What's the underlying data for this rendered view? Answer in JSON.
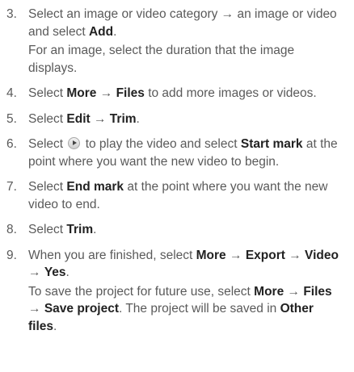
{
  "steps": [
    {
      "number": "3.",
      "paragraphs": [
        [
          {
            "t": "Select an image or video category → an image or video and select "
          },
          {
            "t": "Add",
            "b": true
          },
          {
            "t": "."
          }
        ],
        [
          {
            "t": "For an image, select the duration that the image displays."
          }
        ]
      ]
    },
    {
      "number": "4.",
      "paragraphs": [
        [
          {
            "t": "Select "
          },
          {
            "t": "More",
            "b": true
          },
          {
            "t": " → "
          },
          {
            "t": "Files",
            "b": true
          },
          {
            "t": " to add more images or videos."
          }
        ]
      ]
    },
    {
      "number": "5.",
      "paragraphs": [
        [
          {
            "t": "Select "
          },
          {
            "t": "Edit",
            "b": true
          },
          {
            "t": " → "
          },
          {
            "t": "Trim",
            "b": true
          },
          {
            "t": "."
          }
        ]
      ]
    },
    {
      "number": "6.",
      "paragraphs": [
        [
          {
            "t": "Select "
          },
          {
            "icon": "play-icon"
          },
          {
            "t": " to play the video and select "
          },
          {
            "t": "Start mark",
            "b": true
          },
          {
            "t": " at the point where you want the new video to begin."
          }
        ]
      ]
    },
    {
      "number": "7.",
      "paragraphs": [
        [
          {
            "t": "Select "
          },
          {
            "t": "End mark",
            "b": true
          },
          {
            "t": " at the point where you want the new video to end."
          }
        ]
      ]
    },
    {
      "number": "8.",
      "paragraphs": [
        [
          {
            "t": "Select "
          },
          {
            "t": "Trim",
            "b": true
          },
          {
            "t": "."
          }
        ]
      ]
    },
    {
      "number": "9.",
      "paragraphs": [
        [
          {
            "t": "When you are finished, select "
          },
          {
            "t": "More",
            "b": true
          },
          {
            "t": " → "
          },
          {
            "t": "Export",
            "b": true
          },
          {
            "t": " → "
          },
          {
            "t": "Video",
            "b": true
          },
          {
            "t": " → "
          },
          {
            "t": "Yes",
            "b": true
          },
          {
            "t": "."
          }
        ],
        [
          {
            "t": "To save the project for future use, select "
          },
          {
            "t": "More",
            "b": true
          },
          {
            "t": " → "
          },
          {
            "t": "Files",
            "b": true
          },
          {
            "t": " → "
          },
          {
            "t": "Save project",
            "b": true
          },
          {
            "t": ". The project will be saved in "
          },
          {
            "t": "Other files",
            "b": true
          },
          {
            "t": "."
          }
        ]
      ]
    }
  ]
}
